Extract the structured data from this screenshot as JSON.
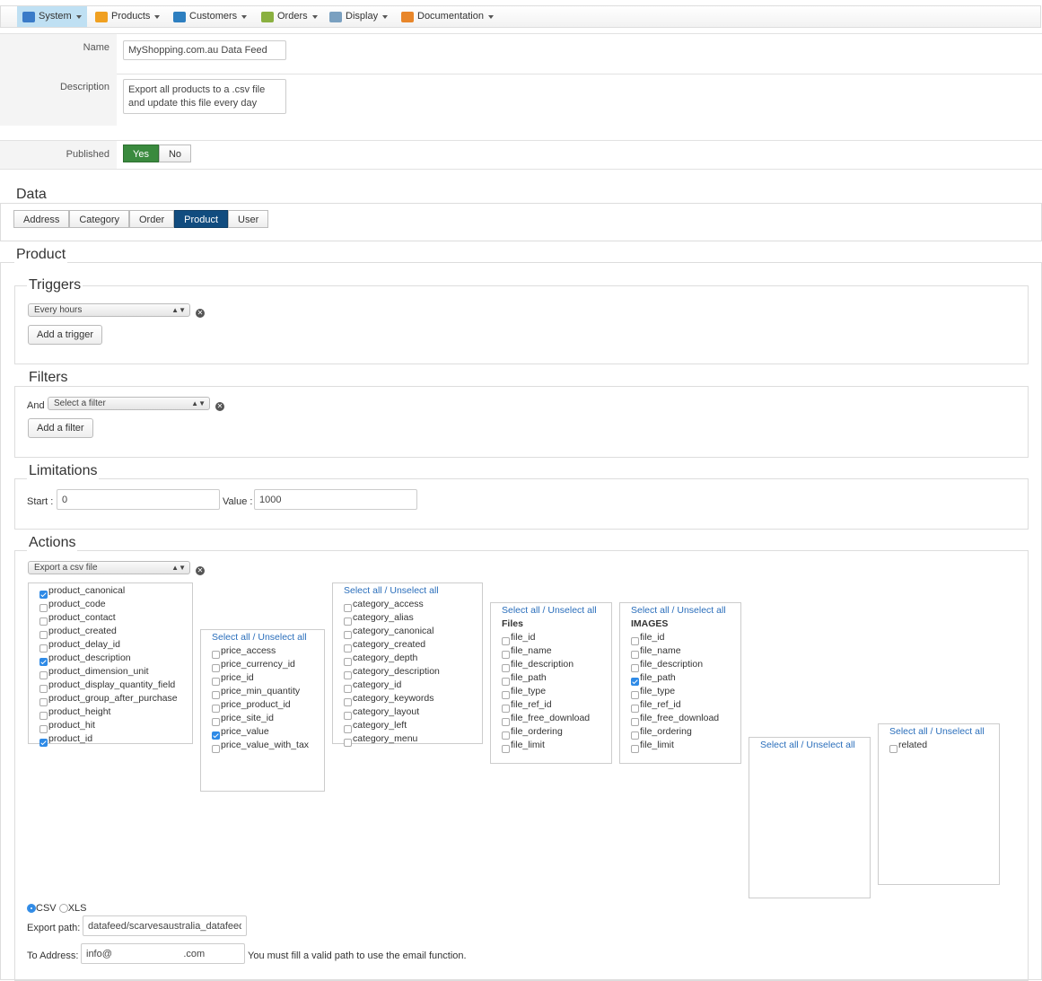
{
  "nav": [
    {
      "label": "System",
      "icon": "tools-icon",
      "color": "#3a7bc8"
    },
    {
      "label": "Products",
      "icon": "box-icon",
      "color": "#f0a020"
    },
    {
      "label": "Customers",
      "icon": "users-icon",
      "color": "#2d7fc0"
    },
    {
      "label": "Orders",
      "icon": "orders-icon",
      "color": "#8ab040"
    },
    {
      "label": "Display",
      "icon": "display-icon",
      "color": "#7aa0c0"
    },
    {
      "label": "Documentation",
      "icon": "help-icon",
      "color": "#e8862a"
    }
  ],
  "form": {
    "name_label": "Name",
    "name_value": "MyShopping.com.au Data Feed",
    "description_label": "Description",
    "description_line1": "Export all products to a .csv file",
    "description_line2": "and update this file every day",
    "published_label": "Published",
    "yes": "Yes",
    "no": "No",
    "published": true
  },
  "data": {
    "legend": "Data",
    "tabs": [
      "Address",
      "Category",
      "Order",
      "Product",
      "User"
    ],
    "active_tab": "Product"
  },
  "product": {
    "legend": "Product",
    "triggers": {
      "legend": "Triggers",
      "select": "Every hours",
      "add": "Add a trigger"
    },
    "filters": {
      "legend": "Filters",
      "and": "And",
      "select": "Select a filter",
      "add": "Add a filter"
    },
    "limitations": {
      "legend": "Limitations",
      "start_label": "Start :",
      "start": "0",
      "value_label": "Value :",
      "value": "1000"
    },
    "actions": {
      "legend": "Actions",
      "select": "Export a csv file",
      "select_all": "Select all",
      "unselect_all": "Unselect all",
      "lists": [
        {
          "header": null,
          "show_select": false,
          "items": [
            [
              "product_canonical",
              true
            ],
            [
              "product_code",
              false
            ],
            [
              "product_contact",
              false
            ],
            [
              "product_created",
              false
            ],
            [
              "product_delay_id",
              false
            ],
            [
              "product_description",
              true
            ],
            [
              "product_dimension_unit",
              false
            ],
            [
              "product_display_quantity_field",
              false
            ],
            [
              "product_group_after_purchase",
              false
            ],
            [
              "product_height",
              false
            ],
            [
              "product_hit",
              false
            ],
            [
              "product_id",
              true
            ]
          ]
        },
        {
          "header": null,
          "show_select": true,
          "items": [
            [
              "price_access",
              false
            ],
            [
              "price_currency_id",
              false
            ],
            [
              "price_id",
              false
            ],
            [
              "price_min_quantity",
              false
            ],
            [
              "price_product_id",
              false
            ],
            [
              "price_site_id",
              false
            ],
            [
              "price_value",
              true
            ],
            [
              "price_value_with_tax",
              false
            ]
          ]
        },
        {
          "header": null,
          "show_select": true,
          "items": [
            [
              "category_access",
              false
            ],
            [
              "category_alias",
              false
            ],
            [
              "category_canonical",
              false
            ],
            [
              "category_created",
              false
            ],
            [
              "category_depth",
              false
            ],
            [
              "category_description",
              false
            ],
            [
              "category_id",
              false
            ],
            [
              "category_keywords",
              false
            ],
            [
              "category_layout",
              false
            ],
            [
              "category_left",
              false
            ],
            [
              "category_menu",
              false
            ]
          ]
        },
        {
          "header": "Files",
          "show_select": true,
          "items": [
            [
              "file_id",
              false
            ],
            [
              "file_name",
              false
            ],
            [
              "file_description",
              false
            ],
            [
              "file_path",
              false
            ],
            [
              "file_type",
              false
            ],
            [
              "file_ref_id",
              false
            ],
            [
              "file_free_download",
              false
            ],
            [
              "file_ordering",
              false
            ],
            [
              "file_limit",
              false
            ]
          ]
        },
        {
          "header": "IMAGES",
          "show_select": true,
          "items": [
            [
              "file_id",
              false
            ],
            [
              "file_name",
              false
            ],
            [
              "file_description",
              false
            ],
            [
              "file_path",
              true
            ],
            [
              "file_type",
              false
            ],
            [
              "file_ref_id",
              false
            ],
            [
              "file_free_download",
              false
            ],
            [
              "file_ordering",
              false
            ],
            [
              "file_limit",
              false
            ]
          ]
        },
        {
          "header": null,
          "show_select": true,
          "items": []
        },
        {
          "header": null,
          "show_select": true,
          "items": [
            [
              "related",
              false
            ]
          ]
        }
      ],
      "format_csv": "CSV",
      "format_xls": "XLS",
      "format_selected": "CSV",
      "export_path_label": "Export path:",
      "export_path": "datafeed/scarvesaustralia_datafeed",
      "to_address_label": "To Address:",
      "to_address": "info@                          .com",
      "email_note": "You must fill a valid path to use the email function."
    }
  }
}
